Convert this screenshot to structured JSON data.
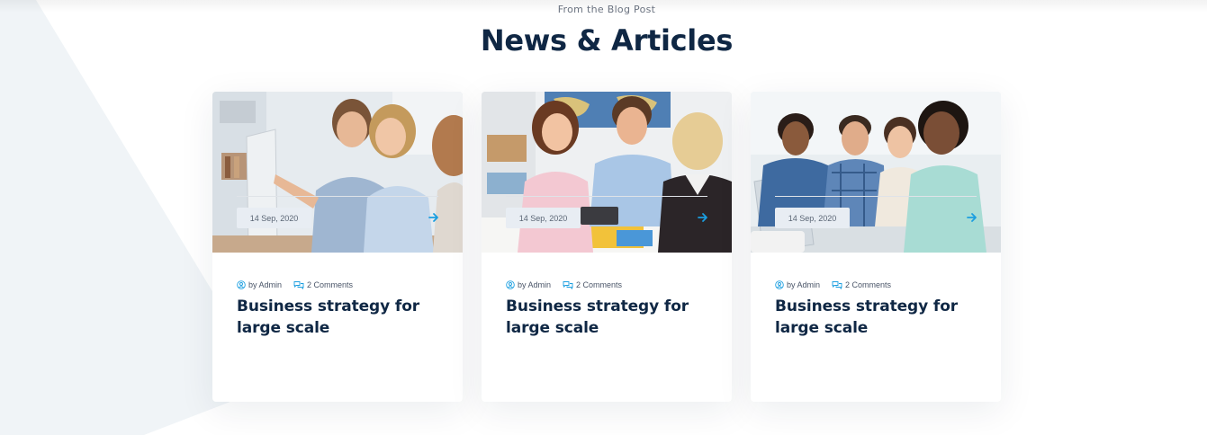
{
  "section": {
    "eyebrow": "From the Blog Post",
    "title": "News & Articles"
  },
  "colors": {
    "heading": "#0f2744",
    "accent": "#1a9ee0",
    "badge_bg": "#e8edf3",
    "bg_shape": "#f0f4f7"
  },
  "posts": [
    {
      "image": "photo of two colleagues smiling at a computer monitor in an office",
      "author": "by Admin",
      "comments": "2 Comments",
      "title": "Business strategy for large scale",
      "date": "14 Sep, 2020",
      "author_icon": "user-circle-icon",
      "comments_icon": "chat-bubbles-icon",
      "arrow_icon": "arrow-right-icon"
    },
    {
      "image": "photo of a young couple meeting with an advisor at a desk",
      "author": "by Admin",
      "comments": "2 Comments",
      "title": "Business strategy for large scale",
      "date": "14 Sep, 2020",
      "author_icon": "user-circle-icon",
      "comments_icon": "chat-bubbles-icon",
      "arrow_icon": "arrow-right-icon"
    },
    {
      "image": "photo of a diverse team working together around a laptop",
      "author": "by Admin",
      "comments": "2 Comments",
      "title": "Business strategy for large scale",
      "date": "14 Sep, 2020",
      "author_icon": "user-circle-icon",
      "comments_icon": "chat-bubbles-icon",
      "arrow_icon": "arrow-right-icon"
    }
  ]
}
